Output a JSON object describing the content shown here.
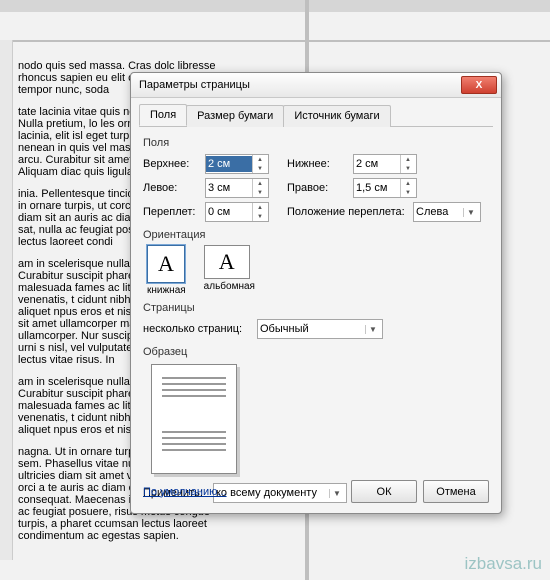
{
  "dialog": {
    "title": "Параметры страницы",
    "tabs": {
      "fields": "Поля",
      "paper": "Размер бумаги",
      "source": "Источник бумаги"
    },
    "margins": {
      "group": "Поля",
      "top_label": "Верхнее:",
      "top_value": "2 см",
      "bottom_label": "Нижнее:",
      "bottom_value": "2 см",
      "left_label": "Левое:",
      "left_value": "3 см",
      "right_label": "Правое:",
      "right_value": "1,5 см",
      "gutter_label": "Переплет:",
      "gutter_value": "0 см",
      "gutter_pos_label": "Положение переплета:",
      "gutter_pos_value": "Слева"
    },
    "orientation": {
      "group": "Ориентация",
      "portrait": "книжная",
      "landscape": "альбомная",
      "glyph": "A"
    },
    "pages": {
      "group": "Страницы",
      "multi_label": "несколько страниц:",
      "multi_value": "Обычный"
    },
    "sample": {
      "group": "Образец"
    },
    "apply": {
      "label": "Применить:",
      "value": "ко всему документу"
    },
    "buttons": {
      "default": "По умолчанию...",
      "ok": "ОК",
      "cancel": "Отмена"
    },
    "close_glyph": "X"
  },
  "watermark": "izbavsa.ru",
  "bgtext": {
    "p1": "nodo quis sed massa. Cras dolc libresse rhoncus sapien eu elit cor iger sit amet tempor nunc, soda",
    "p2": "tate lacinia vitae quis neque. lullamcorper. Nulla pretium, lo les ornare vel. Etiam lacinia, elit isl eget turpis. Quisque tempus nenean in quis vel massa viverra nibus arcu. Curabitur sit amet us nunc accumsan. Aliquam diac quis ligula turpis. Pellen",
    "p3": "inia. Pellentesque tincidunt nunc nagna. Ut in ornare turpis, ut corc unc lobortis ultricies diam sit an auris ac diam et dolor rutrum ec sat, nulla ac feugiat posuere, ris ccumsan lectus laoreet condi",
    "p4": "am in scelerisque nulla, sed et r leo. Curabitur suscipit pharetr et netus et malesuada fames ac lit ac fermentum venenatis, t cidunt nibh porttitor nunc aliquet npus eros et nisi tristique tristiq ger sit amet ullamcorper magna tus molestie ullamcorper. Nur suscipit rutrum vitae eget urni s nisl, vel vulputate dolor. Sed l cipit nisi lectus vitae risus. In",
    "p5": "am in scelerisque nulla, sed et r leo. Curabitur suscipit pharetr et netus et malesuada fames ac lit ac fermentum venenatis, t cidunt nibh porttitor nunc aliquet npus eros et nisi tristique tristiq",
    "p6": "nagna. Ut in ornare turpis, ut consequat sem. Phasellus vitae nulla unc lobortis ultricies diam sit amet venenatis. Mauris a orci a te auris ac diam et dolor rutrum consequat. Maecenas id convallis sat, nulla ac feugiat posuere, risus metus congue turpis, a pharet ccumsan lectus laoreet condimentum ac egestas sapien."
  }
}
